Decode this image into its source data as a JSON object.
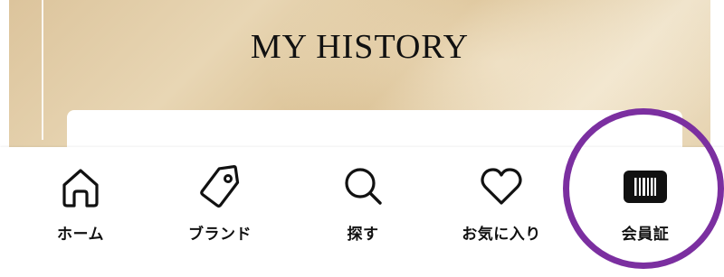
{
  "hero": {
    "title": "MY HISTORY"
  },
  "nav": {
    "items": [
      {
        "label": "ホーム",
        "icon": "home-icon"
      },
      {
        "label": "ブランド",
        "icon": "tag-icon"
      },
      {
        "label": "探す",
        "icon": "search-icon"
      },
      {
        "label": "お気に入り",
        "icon": "heart-icon"
      },
      {
        "label": "会員証",
        "icon": "barcode-card-icon"
      }
    ],
    "highlight_color": "#7b2fa0"
  }
}
